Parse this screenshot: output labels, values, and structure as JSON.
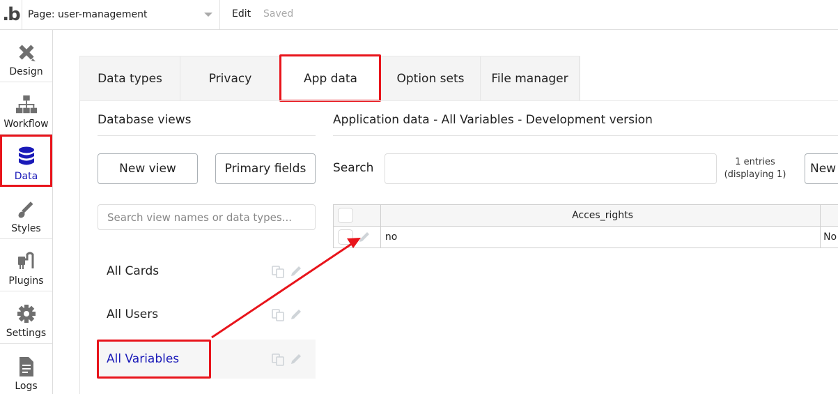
{
  "topbar": {
    "logo": ".b",
    "page_selector": "Page: user-management",
    "edit_label": "Edit",
    "saved_label": "Saved"
  },
  "leftnav": {
    "items": [
      {
        "label": "Design",
        "icon": "design-icon"
      },
      {
        "label": "Workflow",
        "icon": "workflow-icon"
      },
      {
        "label": "Data",
        "icon": "database-icon",
        "active": true
      },
      {
        "label": "Styles",
        "icon": "brush-icon"
      },
      {
        "label": "Plugins",
        "icon": "plug-icon"
      },
      {
        "label": "Settings",
        "icon": "gear-icon"
      },
      {
        "label": "Logs",
        "icon": "document-icon"
      }
    ]
  },
  "tabs": [
    {
      "label": "Data types"
    },
    {
      "label": "Privacy"
    },
    {
      "label": "App data",
      "active": true
    },
    {
      "label": "Option sets"
    },
    {
      "label": "File manager"
    }
  ],
  "database_views": {
    "title": "Database views",
    "new_view_button": "New view",
    "primary_fields_button": "Primary fields",
    "search_placeholder": "Search view names or data types...",
    "views": [
      {
        "label": "All Cards"
      },
      {
        "label": "All Users"
      },
      {
        "label": "All Variables",
        "active": true
      }
    ]
  },
  "app_data": {
    "title": "Application data - All Variables - Development version",
    "search_label": "Search",
    "search_value": "",
    "entries_line1": "1 entries",
    "entries_line2": "(displaying 1)",
    "new_button": "New",
    "columns": [
      "Acces_rights",
      ""
    ],
    "rows": [
      {
        "cells": [
          "no",
          "No"
        ]
      }
    ]
  },
  "colors": {
    "accent_active": "#1a1ab8",
    "annotation_red": "#e8141b"
  }
}
